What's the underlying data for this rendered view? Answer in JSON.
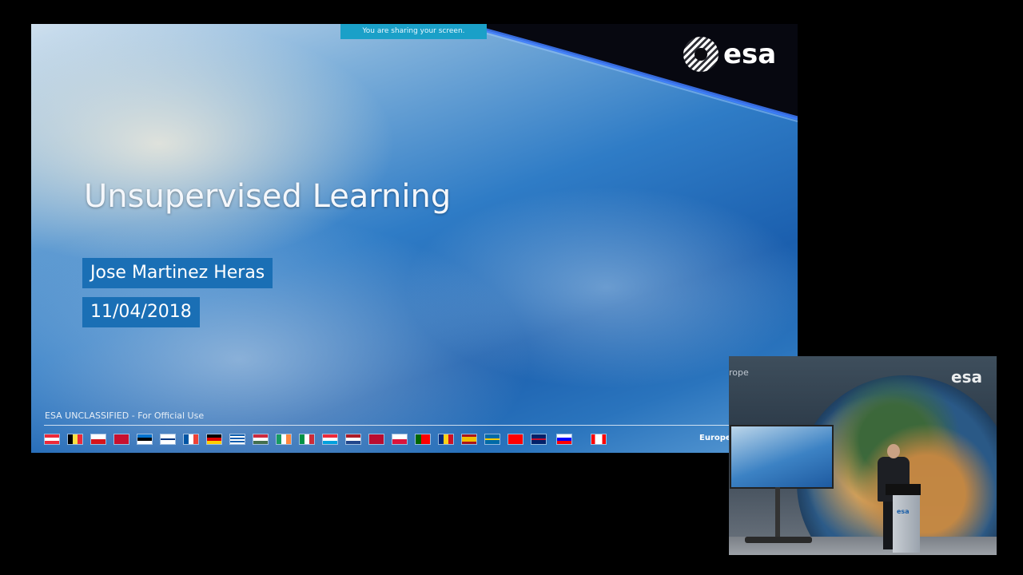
{
  "share_banner": "You are sharing your screen.",
  "slide": {
    "logo_text": "esa",
    "title": "Unsupervised Learning",
    "presenter": "Jose Martinez Heras",
    "date": "11/04/2018",
    "classification": "ESA UNCLASSIFIED - For Official Use",
    "agency": "European Space Agency",
    "flags": [
      "Austria",
      "Belgium",
      "Czech Republic",
      "Denmark",
      "Estonia",
      "Finland",
      "France",
      "Germany",
      "Greece",
      "Hungary",
      "Ireland",
      "Italy",
      "Luxembourg",
      "Netherlands",
      "Norway",
      "Poland",
      "Portugal",
      "Romania",
      "Spain",
      "Sweden",
      "Switzerland",
      "United Kingdom",
      "Slovenia",
      "Canada"
    ]
  },
  "video": {
    "banner_text": "rope",
    "logo_text": "esa",
    "podium_text": "esa"
  },
  "colors": {
    "banner": "#1aa0c8",
    "info_box": "#1a6fb5",
    "background": "#000000"
  }
}
